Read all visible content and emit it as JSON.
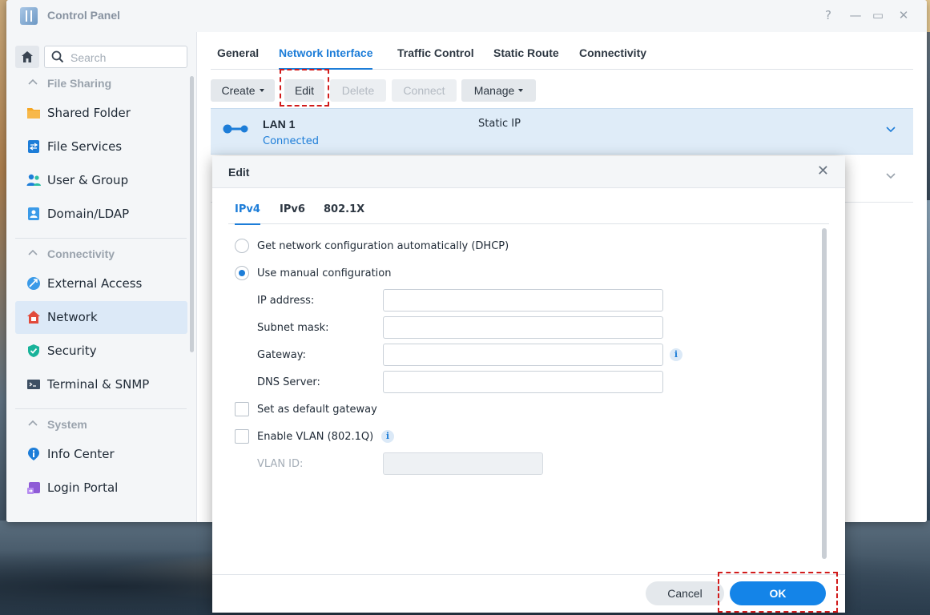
{
  "window": {
    "title": "Control Panel",
    "app_icon": "control-panel-icon"
  },
  "sidebar": {
    "search_placeholder": "Search",
    "sections": [
      {
        "label": "File Sharing",
        "items": [
          {
            "label": "Shared Folder",
            "icon": "folder-icon"
          },
          {
            "label": "File Services",
            "icon": "file-services-icon"
          },
          {
            "label": "User & Group",
            "icon": "user-group-icon"
          },
          {
            "label": "Domain/LDAP",
            "icon": "domain-ldap-icon"
          }
        ]
      },
      {
        "label": "Connectivity",
        "items": [
          {
            "label": "External Access",
            "icon": "external-access-icon"
          },
          {
            "label": "Network",
            "icon": "network-house-icon",
            "active": true
          },
          {
            "label": "Security",
            "icon": "shield-icon"
          },
          {
            "label": "Terminal & SNMP",
            "icon": "terminal-icon"
          }
        ]
      },
      {
        "label": "System",
        "items": [
          {
            "label": "Info Center",
            "icon": "info-center-icon"
          },
          {
            "label": "Login Portal",
            "icon": "login-portal-icon"
          }
        ]
      }
    ]
  },
  "tabs": [
    "General",
    "Network Interface",
    "Traffic Control",
    "Static Route",
    "Connectivity"
  ],
  "active_tab": "Network Interface",
  "toolbar": {
    "create": "Create",
    "edit": "Edit",
    "delete": "Delete",
    "connect": "Connect",
    "manage": "Manage"
  },
  "interfaces": [
    {
      "name": "LAN 1",
      "status": "Connected",
      "type": "Static IP"
    }
  ],
  "dialog": {
    "title": "Edit",
    "tabs": [
      "IPv4",
      "IPv6",
      "802.1X"
    ],
    "dhcp_label": "Get network configuration automatically (DHCP)",
    "manual_label": "Use manual configuration",
    "ip_label": "IP address:",
    "subnet_label": "Subnet mask:",
    "gateway_label": "Gateway:",
    "dns_label": "DNS Server:",
    "default_gw_label": "Set as default gateway",
    "vlan_label": "Enable VLAN (802.1Q)",
    "vlan_id_label": "VLAN ID:",
    "cancel": "Cancel",
    "ok": "OK"
  },
  "colors": {
    "accent": "#1d7dd8",
    "ok_button": "#1484e8",
    "highlight": "#d11b1b"
  }
}
